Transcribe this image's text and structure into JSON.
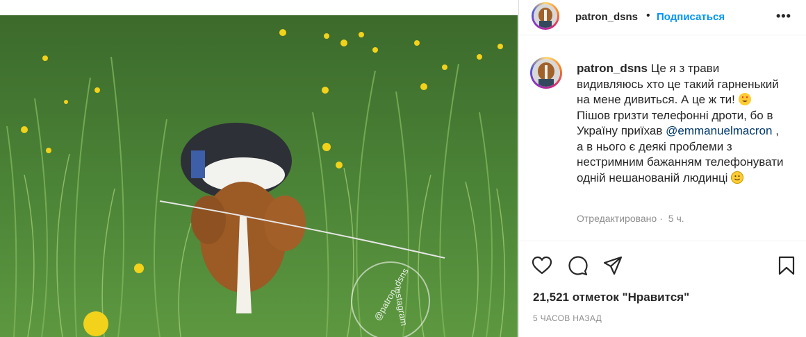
{
  "post": {
    "username": "patron_dsns",
    "follow_label": "Подписаться",
    "separator": "•",
    "more_label": "•••"
  },
  "caption": {
    "username": "patron_dsns",
    "text_part1": "Це я з трави видивляюсь хто це такий гарненький на мене дивиться. А це ж ти!",
    "text_part2": "Пішов гризти телефонні дроти, бо в Україну приїхав",
    "mention": "@emmanuelmacron",
    "text_part3": ", а в нього є деякі проблеми з нестримним бажанням телефонувати одній нешанованій людинці",
    "emoji1": "heart-eyes-emoji",
    "emoji2": "smile-emoji"
  },
  "meta": {
    "edited": "Отредактировано",
    "dot": "·",
    "age": "5 ч."
  },
  "likes": {
    "text": "21,521 отметок \"Нравится\""
  },
  "timestamp": {
    "text": "5 ЧАСОВ НАЗАД"
  },
  "photo": {
    "watermark_top": "@patron_dsns",
    "watermark_bottom": "instagram"
  },
  "icons": {
    "like": "heart-outline-icon",
    "comment": "comment-bubble-icon",
    "share": "paper-plane-icon",
    "save": "bookmark-icon"
  }
}
